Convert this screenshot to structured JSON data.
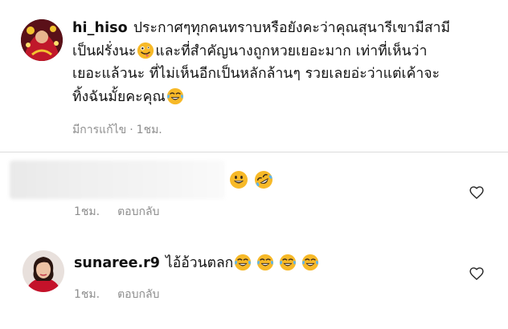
{
  "caption": {
    "username": "hi_hiso",
    "line1": "ประกาศๆทุกคนทราบหรือยังคะว่าคุณสุนารีเขามีสามี",
    "line2a": "เป็นฝรั่งนะ",
    "line2b": "และที่สำคัญนางถูกหวยเยอะมาก เท่าที่เห็นว่า",
    "line3": "เยอะแล้วนะ ที่ไม่เห็นอีกเป็นหลักล้านๆ รวยเลยอ่ะว่าแต่เค้าจะ",
    "line4": "ทิ้งฉันมั้ยคะคุณ",
    "edited": "มีการแก้ไข",
    "separator": "·",
    "time": "1ชม."
  },
  "comments": [
    {
      "username": "",
      "text": "",
      "emojis": [
        "grinning-face-icon",
        "rolling-laughing-face-icon"
      ],
      "time": "1ชม.",
      "reply": "ตอบกลับ"
    },
    {
      "username": "sunaree.r9",
      "text": "ไอ้อ้วนตลก",
      "emojis": [
        "tears-of-joy-icon",
        "tears-of-joy-icon",
        "tears-of-joy-icon",
        "tears-of-joy-icon"
      ],
      "time": "1ชม.",
      "reply": "ตอบกลับ"
    }
  ],
  "colors": {
    "text": "#111111",
    "meta": "#8e8e8e",
    "divider": "#dbdbdb",
    "emoji_yellow": "#f7b928"
  }
}
